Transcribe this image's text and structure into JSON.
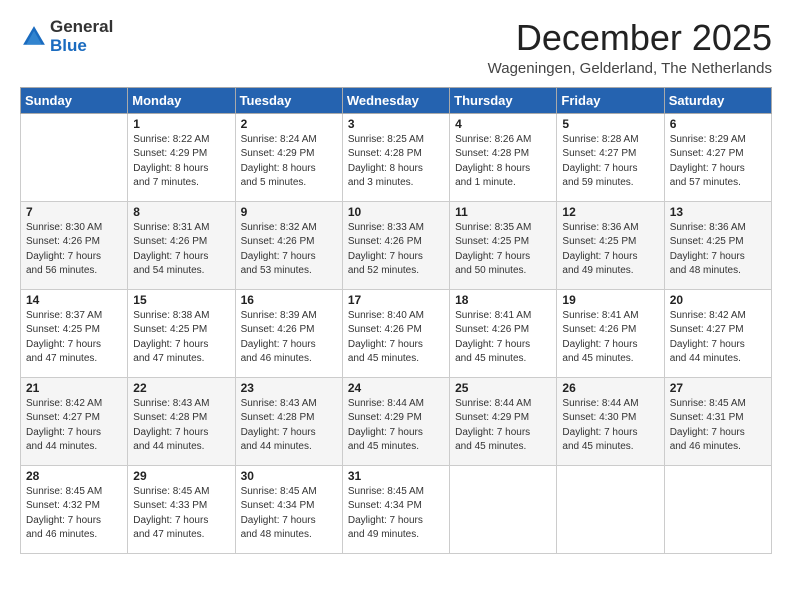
{
  "logo": {
    "general": "General",
    "blue": "Blue"
  },
  "header": {
    "month": "December 2025",
    "location": "Wageningen, Gelderland, The Netherlands"
  },
  "weekdays": [
    "Sunday",
    "Monday",
    "Tuesday",
    "Wednesday",
    "Thursday",
    "Friday",
    "Saturday"
  ],
  "weeks": [
    [
      {
        "num": "",
        "info": ""
      },
      {
        "num": "1",
        "info": "Sunrise: 8:22 AM\nSunset: 4:29 PM\nDaylight: 8 hours\nand 7 minutes."
      },
      {
        "num": "2",
        "info": "Sunrise: 8:24 AM\nSunset: 4:29 PM\nDaylight: 8 hours\nand 5 minutes."
      },
      {
        "num": "3",
        "info": "Sunrise: 8:25 AM\nSunset: 4:28 PM\nDaylight: 8 hours\nand 3 minutes."
      },
      {
        "num": "4",
        "info": "Sunrise: 8:26 AM\nSunset: 4:28 PM\nDaylight: 8 hours\nand 1 minute."
      },
      {
        "num": "5",
        "info": "Sunrise: 8:28 AM\nSunset: 4:27 PM\nDaylight: 7 hours\nand 59 minutes."
      },
      {
        "num": "6",
        "info": "Sunrise: 8:29 AM\nSunset: 4:27 PM\nDaylight: 7 hours\nand 57 minutes."
      }
    ],
    [
      {
        "num": "7",
        "info": "Sunrise: 8:30 AM\nSunset: 4:26 PM\nDaylight: 7 hours\nand 56 minutes."
      },
      {
        "num": "8",
        "info": "Sunrise: 8:31 AM\nSunset: 4:26 PM\nDaylight: 7 hours\nand 54 minutes."
      },
      {
        "num": "9",
        "info": "Sunrise: 8:32 AM\nSunset: 4:26 PM\nDaylight: 7 hours\nand 53 minutes."
      },
      {
        "num": "10",
        "info": "Sunrise: 8:33 AM\nSunset: 4:26 PM\nDaylight: 7 hours\nand 52 minutes."
      },
      {
        "num": "11",
        "info": "Sunrise: 8:35 AM\nSunset: 4:25 PM\nDaylight: 7 hours\nand 50 minutes."
      },
      {
        "num": "12",
        "info": "Sunrise: 8:36 AM\nSunset: 4:25 PM\nDaylight: 7 hours\nand 49 minutes."
      },
      {
        "num": "13",
        "info": "Sunrise: 8:36 AM\nSunset: 4:25 PM\nDaylight: 7 hours\nand 48 minutes."
      }
    ],
    [
      {
        "num": "14",
        "info": "Sunrise: 8:37 AM\nSunset: 4:25 PM\nDaylight: 7 hours\nand 47 minutes."
      },
      {
        "num": "15",
        "info": "Sunrise: 8:38 AM\nSunset: 4:25 PM\nDaylight: 7 hours\nand 47 minutes."
      },
      {
        "num": "16",
        "info": "Sunrise: 8:39 AM\nSunset: 4:26 PM\nDaylight: 7 hours\nand 46 minutes."
      },
      {
        "num": "17",
        "info": "Sunrise: 8:40 AM\nSunset: 4:26 PM\nDaylight: 7 hours\nand 45 minutes."
      },
      {
        "num": "18",
        "info": "Sunrise: 8:41 AM\nSunset: 4:26 PM\nDaylight: 7 hours\nand 45 minutes."
      },
      {
        "num": "19",
        "info": "Sunrise: 8:41 AM\nSunset: 4:26 PM\nDaylight: 7 hours\nand 45 minutes."
      },
      {
        "num": "20",
        "info": "Sunrise: 8:42 AM\nSunset: 4:27 PM\nDaylight: 7 hours\nand 44 minutes."
      }
    ],
    [
      {
        "num": "21",
        "info": "Sunrise: 8:42 AM\nSunset: 4:27 PM\nDaylight: 7 hours\nand 44 minutes."
      },
      {
        "num": "22",
        "info": "Sunrise: 8:43 AM\nSunset: 4:28 PM\nDaylight: 7 hours\nand 44 minutes."
      },
      {
        "num": "23",
        "info": "Sunrise: 8:43 AM\nSunset: 4:28 PM\nDaylight: 7 hours\nand 44 minutes."
      },
      {
        "num": "24",
        "info": "Sunrise: 8:44 AM\nSunset: 4:29 PM\nDaylight: 7 hours\nand 45 minutes."
      },
      {
        "num": "25",
        "info": "Sunrise: 8:44 AM\nSunset: 4:29 PM\nDaylight: 7 hours\nand 45 minutes."
      },
      {
        "num": "26",
        "info": "Sunrise: 8:44 AM\nSunset: 4:30 PM\nDaylight: 7 hours\nand 45 minutes."
      },
      {
        "num": "27",
        "info": "Sunrise: 8:45 AM\nSunset: 4:31 PM\nDaylight: 7 hours\nand 46 minutes."
      }
    ],
    [
      {
        "num": "28",
        "info": "Sunrise: 8:45 AM\nSunset: 4:32 PM\nDaylight: 7 hours\nand 46 minutes."
      },
      {
        "num": "29",
        "info": "Sunrise: 8:45 AM\nSunset: 4:33 PM\nDaylight: 7 hours\nand 47 minutes."
      },
      {
        "num": "30",
        "info": "Sunrise: 8:45 AM\nSunset: 4:34 PM\nDaylight: 7 hours\nand 48 minutes."
      },
      {
        "num": "31",
        "info": "Sunrise: 8:45 AM\nSunset: 4:34 PM\nDaylight: 7 hours\nand 49 minutes."
      },
      {
        "num": "",
        "info": ""
      },
      {
        "num": "",
        "info": ""
      },
      {
        "num": "",
        "info": ""
      }
    ]
  ]
}
